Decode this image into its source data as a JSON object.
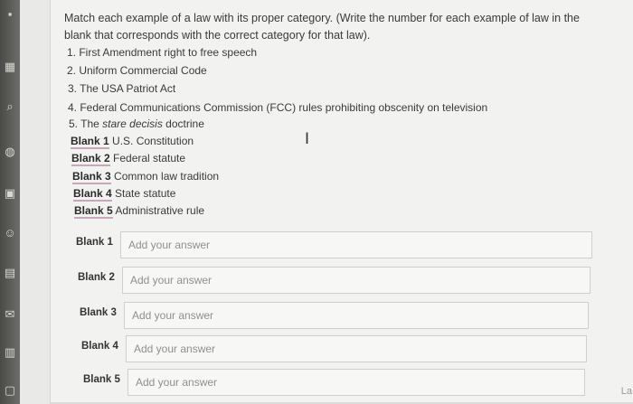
{
  "question": {
    "line1": "Match each example of a law with its proper category. (Write the number for each example of law in the",
    "line2": "blank that corresponds with the correct category for that law)."
  },
  "examples": [
    {
      "text": "1. First Amendment right to free speech"
    },
    {
      "text": "2. Uniform Commercial Code"
    },
    {
      "text": "3. The USA Patriot Act"
    },
    {
      "text": "4. Federal Communications Commission (FCC) rules prohibiting obscenity on television"
    },
    {
      "prefix": "5. The ",
      "italic": "stare decisis",
      "suffix": " doctrine"
    }
  ],
  "blanks": [
    {
      "label": "Blank 1",
      "category": " U.S. Constitution"
    },
    {
      "label": "Blank 2",
      "category": " Federal statute"
    },
    {
      "label": "Blank 3",
      "category": " Common law tradition"
    },
    {
      "label": "Blank 4",
      "category": " State statute"
    },
    {
      "label": "Blank 5",
      "category": " Administrative rule"
    }
  ],
  "answers": [
    {
      "label": "Blank 1",
      "placeholder": "Add your answer",
      "value": ""
    },
    {
      "label": "Blank 2",
      "placeholder": "Add your answer",
      "value": ""
    },
    {
      "label": "Blank 3",
      "placeholder": "Add your answer",
      "value": ""
    },
    {
      "label": "Blank 4",
      "placeholder": "Add your answer",
      "value": ""
    },
    {
      "label": "Blank 5",
      "placeholder": "Add your answer",
      "value": ""
    }
  ],
  "icons": [
    "text-cursor-icon"
  ],
  "corner_text": "La"
}
